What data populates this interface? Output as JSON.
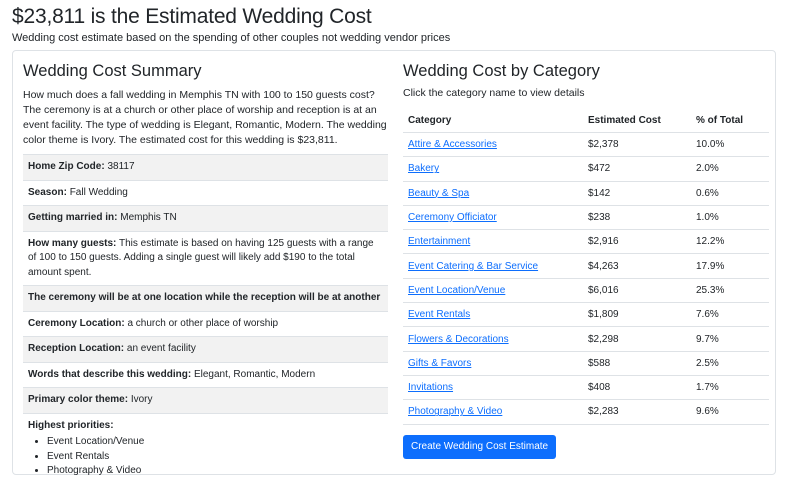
{
  "header": {
    "title": "$23,811 is the Estimated Wedding Cost",
    "subtitle": "Wedding cost estimate based on the spending of other couples not wedding vendor prices"
  },
  "summary": {
    "heading": "Wedding Cost Summary",
    "intro": "How much does a fall wedding in Memphis TN with 100 to 150 guests cost? The ceremony is at a church or other place of worship and reception is at an event facility. The type of wedding is Elegant, Romantic, Modern. The wedding color theme is Ivory. The estimated cost for this wedding is $23,811.",
    "rows": [
      {
        "label": "Home Zip Code:",
        "value": "38117"
      },
      {
        "label": "Season:",
        "value": "Fall Wedding"
      },
      {
        "label": "Getting married in:",
        "value": "Memphis TN"
      },
      {
        "label": "How many guests:",
        "value": "This estimate is based on having 125 guests with a range of 100 to 150 guests. Adding a single guest will likely add $190 to the total amount spent."
      },
      {
        "label": "The ceremony will be at one location while the reception will be at another",
        "value": ""
      },
      {
        "label": "Ceremony Location:",
        "value": "a church or other place of worship"
      },
      {
        "label": "Reception Location:",
        "value": "an event facility"
      },
      {
        "label": "Words that describe this wedding:",
        "value": "Elegant, Romantic, Modern"
      },
      {
        "label": "Primary color theme:",
        "value": "Ivory"
      }
    ],
    "priorities_label": "Highest priorities:",
    "priorities": [
      "Event Location/Venue",
      "Event Rentals",
      "Photography & Video"
    ]
  },
  "category": {
    "heading": "Wedding Cost by Category",
    "subheading": "Click the category name to view details",
    "columns": [
      "Category",
      "Estimated Cost",
      "% of Total"
    ],
    "rows": [
      {
        "name": "Attire & Accessories",
        "cost": "$2,378",
        "pct": "10.0%"
      },
      {
        "name": "Bakery",
        "cost": "$472",
        "pct": "2.0%"
      },
      {
        "name": "Beauty & Spa",
        "cost": "$142",
        "pct": "0.6%"
      },
      {
        "name": "Ceremony Officiator",
        "cost": "$238",
        "pct": "1.0%"
      },
      {
        "name": "Entertainment",
        "cost": "$2,916",
        "pct": "12.2%"
      },
      {
        "name": "Event Catering & Bar Service",
        "cost": "$4,263",
        "pct": "17.9%"
      },
      {
        "name": "Event Location/Venue",
        "cost": "$6,016",
        "pct": "25.3%"
      },
      {
        "name": "Event Rentals",
        "cost": "$1,809",
        "pct": "7.6%"
      },
      {
        "name": "Flowers & Decorations",
        "cost": "$2,298",
        "pct": "9.7%"
      },
      {
        "name": "Gifts & Favors",
        "cost": "$588",
        "pct": "2.5%"
      },
      {
        "name": "Invitations",
        "cost": "$408",
        "pct": "1.7%"
      },
      {
        "name": "Photography & Video",
        "cost": "$2,283",
        "pct": "9.6%"
      }
    ],
    "button_label": "Create Wedding Cost Estimate",
    "link_color": "#0d6efd",
    "button_color": "#0d6efd"
  }
}
